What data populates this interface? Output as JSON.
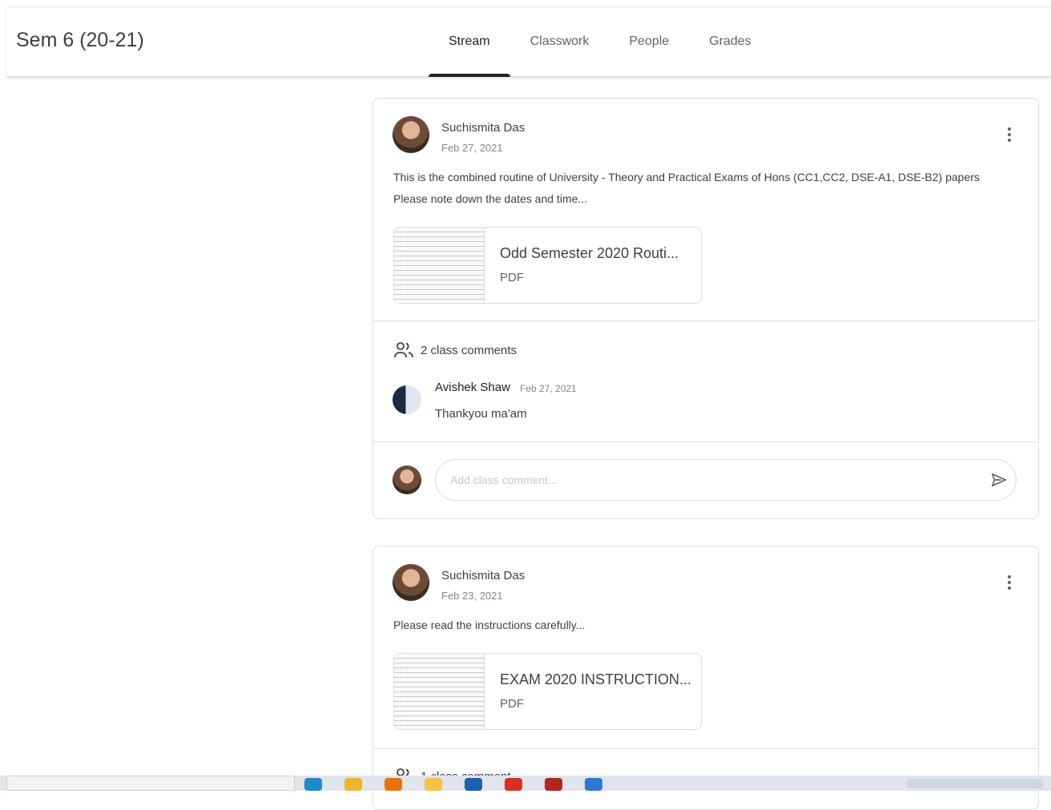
{
  "header": {
    "class_title": "Sem 6 (20-21)",
    "tabs": [
      {
        "label": "Stream",
        "active": true
      },
      {
        "label": "Classwork",
        "active": false
      },
      {
        "label": "People",
        "active": false
      },
      {
        "label": "Grades",
        "active": false
      }
    ]
  },
  "posts": [
    {
      "author": "Suchismita Das",
      "date": "Feb 27, 2021",
      "body_lines": [
        "This is the combined routine of University - Theory and Practical Exams of Hons (CC1,CC2, DSE-A1, DSE-B2) papers",
        "Please note down the dates and time..."
      ],
      "attachment": {
        "title": "Odd Semester 2020 Routi...",
        "type": "PDF"
      },
      "comments_label": "2 class comments",
      "comment": {
        "author": "Avishek Shaw",
        "date": "Feb 27, 2021",
        "text": "Thankyou ma'am"
      },
      "comment_placeholder": "Add class comment..."
    },
    {
      "author": "Suchismita Das",
      "date": "Feb 23, 2021",
      "body_lines": [
        "Please read the instructions carefully..."
      ],
      "attachment": {
        "title": "EXAM 2020 INSTRUCTION...",
        "type": "PDF"
      },
      "comments_label": "1 class comment"
    }
  ],
  "colors": {
    "active_tab_indicator": "#202124",
    "border": "#dadce0",
    "muted_text": "#80868b"
  },
  "icons": {
    "more": "more-vert-icon",
    "people": "people-icon",
    "send": "send-icon"
  }
}
